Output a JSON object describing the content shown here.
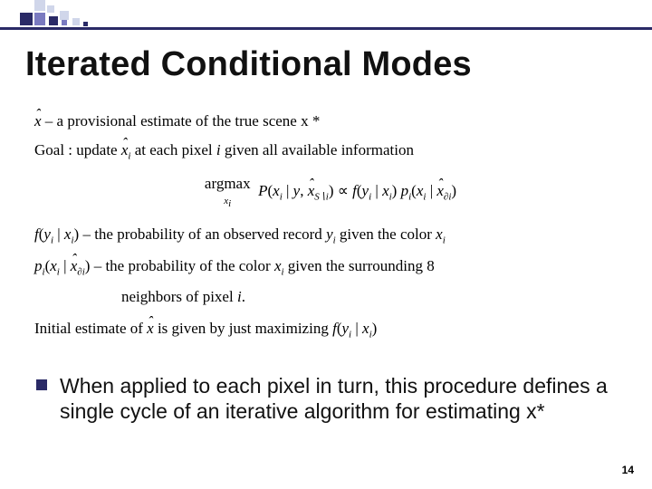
{
  "accent": {
    "bar_color": "#2a2a66"
  },
  "title": "Iterated Conditional Modes",
  "math": {
    "line1_pre": "x̂ – a provisional estimate of the true scene x *",
    "line2": "Goal : update x̂ᵢ at each pixel i given all available information",
    "formula": "argmax  P(xᵢ | y, x̂_{S∖i}) ∝ f(yᵢ | xᵢ) pᵢ(xᵢ | x̂_{∂i})",
    "formula_sub": "xᵢ",
    "line3": "f(yᵢ | xᵢ) – the probability of an observed record yᵢ given the color xᵢ",
    "line4": "pᵢ(xᵢ | x̂_{∂i}) – the probability of the color xᵢ given the surrounding 8",
    "line4b": "neighbors of pixel i.",
    "line5": "Initial estimate of x̂ is given by just maximizing f(yᵢ | xᵢ)"
  },
  "bullet": "When applied to each pixel in turn, this procedure defines a single cycle of an iterative algorithm for estimating x*",
  "page_number": "14"
}
